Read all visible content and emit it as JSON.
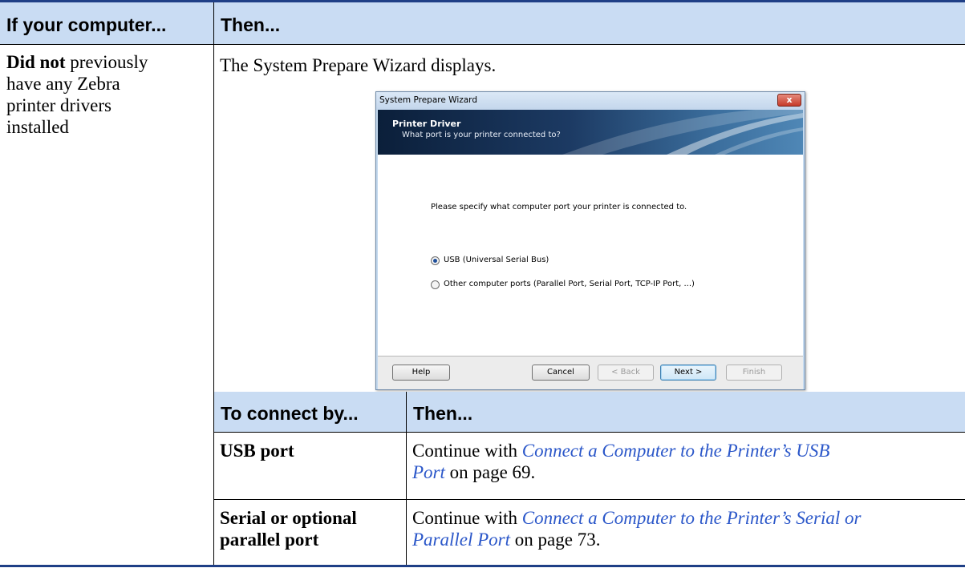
{
  "table": {
    "header": {
      "col1": "If your computer...",
      "col2": "Then..."
    },
    "row": {
      "condition_bold": "Did not",
      "condition_lines": [
        "previously",
        "have any Zebra",
        "printer drivers",
        "installed"
      ],
      "result": "The System Prepare Wizard displays."
    },
    "sub_table": {
      "header": {
        "col1": "To connect by...",
        "col2": "Then..."
      },
      "rows": [
        {
          "method": "USB port",
          "prefix": "Continue with ",
          "link_line1": "Connect a Computer to the Printer’s USB",
          "link_line2": "Port",
          "suffix": " on page 69."
        },
        {
          "method_line1": "Serial or optional",
          "method_line2": "parallel port",
          "prefix": "Continue with ",
          "link_line1": "Connect a Computer to the Printer’s Serial or",
          "link_line2": "Parallel Port",
          "suffix": " on page 73."
        }
      ]
    }
  },
  "dialog": {
    "title": "System Prepare Wizard",
    "close_glyph": "x",
    "banner_title": "Printer Driver",
    "banner_subtitle": "What port is your printer connected to?",
    "prompt": "Please specify what computer port your printer is connected to.",
    "options": [
      {
        "label": "USB (Universal Serial Bus)",
        "selected": true
      },
      {
        "label": "Other computer ports (Parallel Port, Serial Port, TCP-IP Port, ...)",
        "selected": false
      }
    ],
    "buttons": {
      "help": "Help",
      "cancel": "Cancel",
      "back": "< Back",
      "next": "Next >",
      "finish": "Finish"
    }
  },
  "colors": {
    "header_fill": "#c9dcf3",
    "rule": "#1f3f86",
    "link": "#2b57c9"
  }
}
